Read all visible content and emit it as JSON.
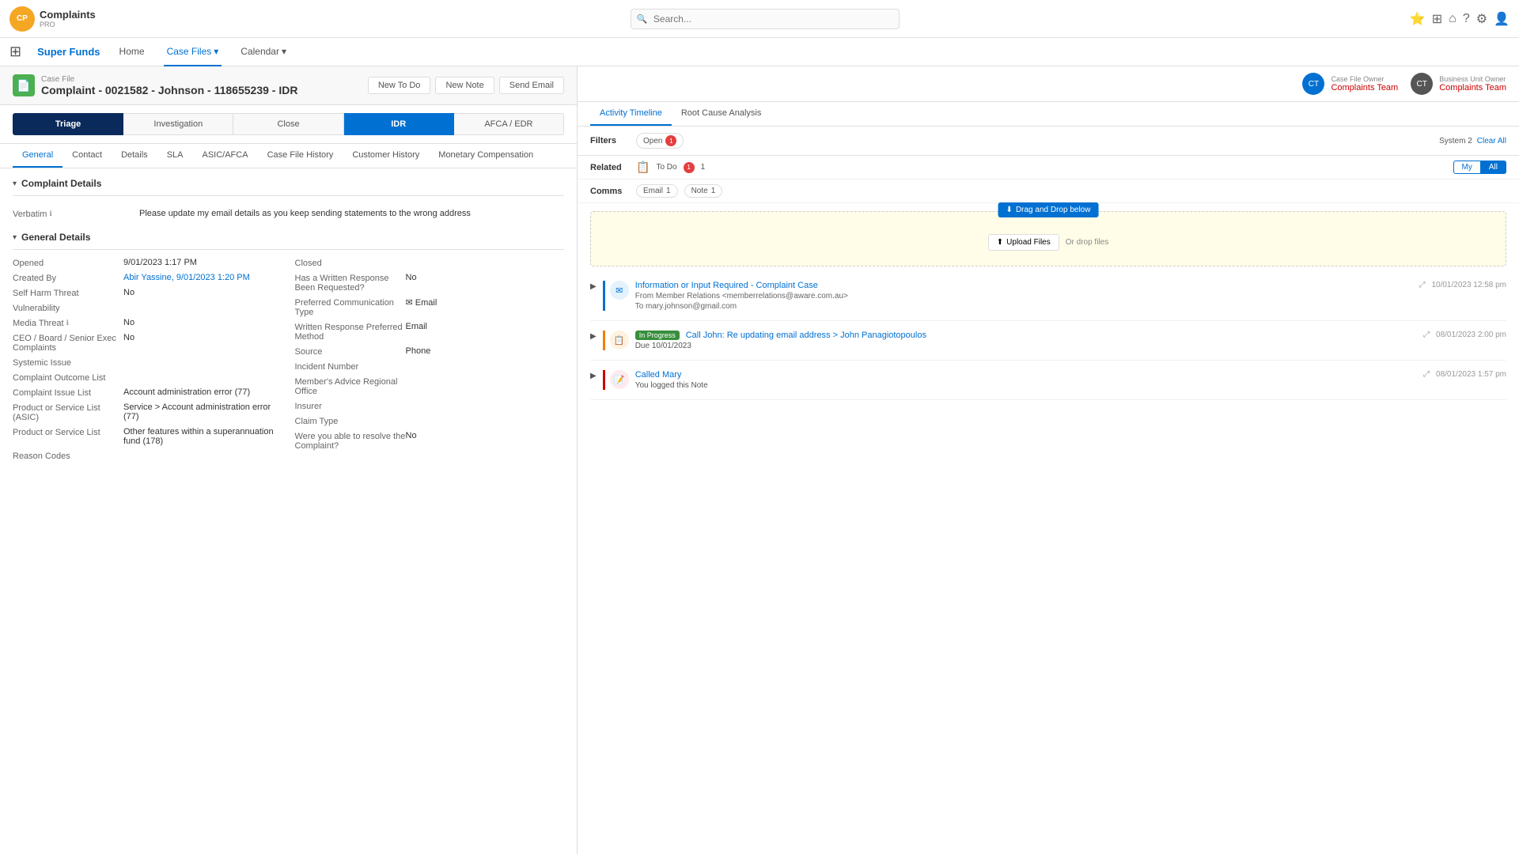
{
  "topbar": {
    "logo_text": "Complaints",
    "logo_sub": "PRO",
    "search_placeholder": "Search...",
    "icons": [
      "⭐",
      "⊞",
      "⌂",
      "?",
      "⚙",
      "👤"
    ]
  },
  "navbar": {
    "app_name": "Super Funds",
    "items": [
      {
        "label": "Home",
        "active": false
      },
      {
        "label": "Case Files",
        "active": true,
        "has_dropdown": true
      },
      {
        "label": "Calendar",
        "active": false,
        "has_dropdown": true
      }
    ]
  },
  "case_header": {
    "label": "Case File",
    "title": "Complaint - 0021582 - Johnson - 118655239 - IDR",
    "buttons": [
      {
        "label": "New To Do",
        "type": "outline"
      },
      {
        "label": "New Note",
        "type": "outline"
      },
      {
        "label": "Send Email",
        "type": "outline"
      }
    ]
  },
  "progress_steps": [
    {
      "label": "Triage",
      "state": "active-triage"
    },
    {
      "label": "Investigation",
      "state": ""
    },
    {
      "label": "Close",
      "state": ""
    },
    {
      "label": "IDR",
      "state": "active-idr"
    },
    {
      "label": "AFCA / EDR",
      "state": ""
    }
  ],
  "sub_tabs": [
    {
      "label": "General",
      "active": true
    },
    {
      "label": "Contact",
      "active": false
    },
    {
      "label": "Details",
      "active": false
    },
    {
      "label": "SLA",
      "active": false
    },
    {
      "label": "ASIC/AFCA",
      "active": false
    },
    {
      "label": "Case File History",
      "active": false
    },
    {
      "label": "Customer History",
      "active": false
    },
    {
      "label": "Monetary Compensation",
      "active": false
    }
  ],
  "complaint_details": {
    "section_title": "Complaint Details",
    "verbatim_label": "Verbatim",
    "verbatim_value": "Please update my email details as you keep sending statements to the wrong address"
  },
  "general_details": {
    "section_title": "General Details",
    "left_fields": [
      {
        "label": "Opened",
        "value": "9/01/2023 1:17 PM"
      },
      {
        "label": "Created By",
        "value": "Abir Yassine, 9/01/2023 1:20 PM",
        "is_link": true
      },
      {
        "label": "Self Harm Threat",
        "value": "No"
      },
      {
        "label": "Vulnerability",
        "value": ""
      },
      {
        "label": "Media Threat",
        "value": "No",
        "has_info": true
      },
      {
        "label": "CEO / Board / Senior Exec Complaints",
        "value": "No"
      },
      {
        "label": "Systemic Issue",
        "value": ""
      },
      {
        "label": "Complaint Outcome List",
        "value": ""
      },
      {
        "label": "Complaint Issue List",
        "value": "Account administration error (77)"
      },
      {
        "label": "Product or Service List (ASIC)",
        "value": "Service > Account administration error (77)"
      },
      {
        "label": "Product or Service List",
        "value": "Other features within a superannuation fund (178)"
      },
      {
        "label": "Reason Codes",
        "value": ""
      }
    ],
    "right_fields": [
      {
        "label": "Closed",
        "value": ""
      },
      {
        "label": "Has a Written Response Been Requested?",
        "value": "No"
      },
      {
        "label": "Preferred Communication Type",
        "value": "Email",
        "has_icon": true
      },
      {
        "label": "Written Response Preferred Method",
        "value": "Email"
      },
      {
        "label": "Source",
        "value": "Phone"
      },
      {
        "label": "Incident Number",
        "value": ""
      },
      {
        "label": "Member's Advice Regional Office",
        "value": ""
      },
      {
        "label": "Insurer",
        "value": ""
      },
      {
        "label": "Claim Type",
        "value": ""
      },
      {
        "label": "Were you able to resolve the Complaint?",
        "value": "No"
      }
    ]
  },
  "right_panel": {
    "case_file_owner_label": "Case File Owner",
    "case_file_owner_name": "Complaints Team",
    "business_unit_owner_label": "Business Unit Owner",
    "business_unit_owner_name": "Complaints Team"
  },
  "activity_tabs": [
    {
      "label": "Activity Timeline",
      "active": true
    },
    {
      "label": "Root Cause Analysis",
      "active": false
    }
  ],
  "filters": {
    "label": "Filters",
    "open_badge": "Open",
    "open_count": "1",
    "system_label": "System",
    "system_count": "2",
    "clear_all": "Clear All"
  },
  "related": {
    "label": "Related",
    "todo_label": "To Do",
    "todo_count": "1",
    "toggle_my": "My",
    "toggle_all": "All"
  },
  "comms": {
    "label": "Comms",
    "email_label": "Email",
    "email_count": "1",
    "note_label": "Note",
    "note_count": "1"
  },
  "drop_zone": {
    "drag_drop_label": "Drag and Drop below",
    "upload_label": "Upload Files",
    "or_text": "Or drop files"
  },
  "activity_items": [
    {
      "icon_type": "blue",
      "icon_char": "✉",
      "title": "Information or Input Required - Complaint Case",
      "from": "From Member Relations <memberrelations@aware.com.au>",
      "to": "To mary.johnson@gmail.com",
      "time": "10/01/2023 12:58 pm",
      "border": "blue"
    },
    {
      "icon_type": "orange",
      "icon_char": "📋",
      "badge": "In Progress",
      "title": "Call John: Re updating email address > John Panagiotopoulos",
      "due": "Due 10/01/2023",
      "time": "08/01/2023 2:00 pm",
      "border": "orange"
    },
    {
      "icon_type": "red",
      "icon_char": "📝",
      "title": "Called Mary",
      "sub": "You logged this Note",
      "time": "08/01/2023 1:57 pm",
      "border": "red"
    }
  ]
}
